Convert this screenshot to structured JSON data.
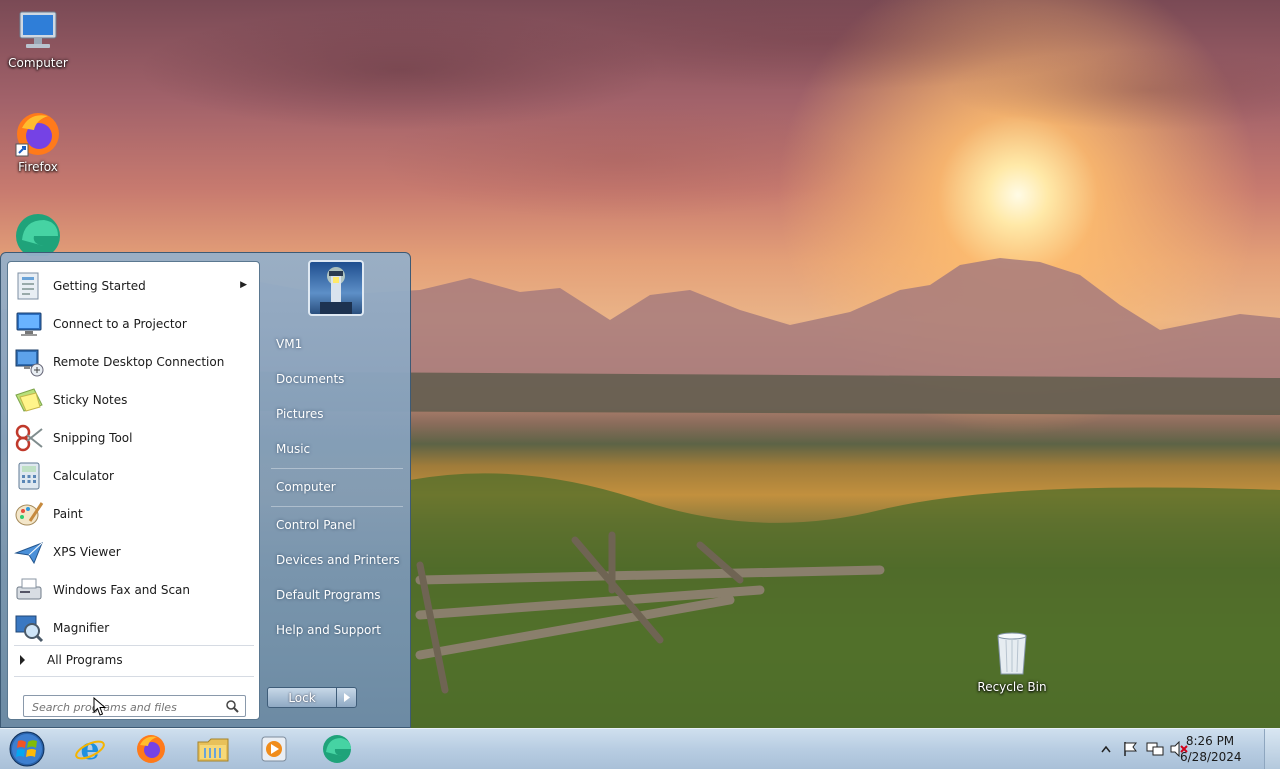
{
  "desktop": {
    "icons": [
      {
        "label": "Computer",
        "icon": "computer-icon"
      },
      {
        "label": "Firefox",
        "icon": "firefox-icon"
      },
      {
        "label": "",
        "icon": "edge-icon"
      },
      {
        "label": "Recycle Bin",
        "icon": "recycle-bin-icon"
      }
    ]
  },
  "start_menu": {
    "programs": [
      {
        "label": "Getting Started",
        "icon": "getting-started-icon",
        "has_submenu": true
      },
      {
        "label": "Connect to a Projector",
        "icon": "projector-icon"
      },
      {
        "label": "Remote Desktop Connection",
        "icon": "remote-desktop-icon"
      },
      {
        "label": "Sticky Notes",
        "icon": "sticky-notes-icon"
      },
      {
        "label": "Snipping Tool",
        "icon": "snipping-tool-icon"
      },
      {
        "label": "Calculator",
        "icon": "calculator-icon"
      },
      {
        "label": "Paint",
        "icon": "paint-icon"
      },
      {
        "label": "XPS Viewer",
        "icon": "xps-viewer-icon"
      },
      {
        "label": "Windows Fax and Scan",
        "icon": "fax-scan-icon"
      },
      {
        "label": "Magnifier",
        "icon": "magnifier-icon"
      }
    ],
    "all_programs_label": "All Programs",
    "search_placeholder": "Search programs and files",
    "right_items": [
      "VM1",
      "Documents",
      "Pictures",
      "Music",
      "Computer",
      "Control Panel",
      "Devices and Printers",
      "Default Programs",
      "Help and Support"
    ],
    "lock_label": "Lock"
  },
  "taskbar": {
    "pinned": [
      "internet-explorer-icon",
      "firefox-icon",
      "file-explorer-icon",
      "media-player-icon",
      "edge-icon"
    ],
    "tray_icons": [
      "show-hidden-icons-icon",
      "action-center-flag-icon",
      "network-icon",
      "volume-muted-icon"
    ],
    "time": "8:26 PM",
    "date": "6/28/2024"
  }
}
